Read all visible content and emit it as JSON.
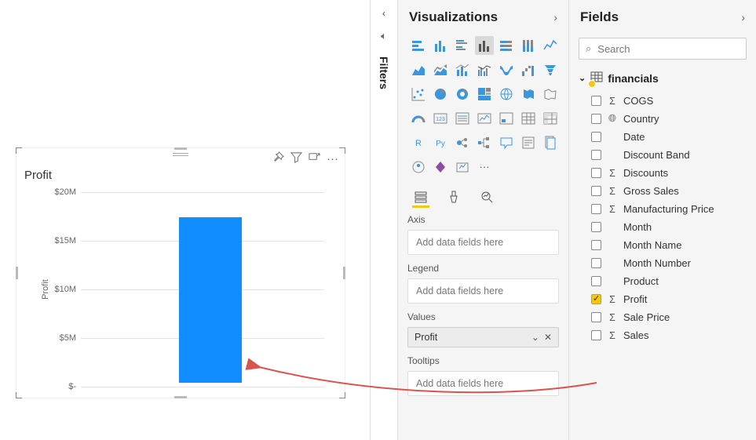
{
  "panes": {
    "filters_label": "Filters",
    "visualizations_label": "Visualizations",
    "fields_label": "Fields"
  },
  "search": {
    "placeholder": "Search"
  },
  "chart_data": {
    "type": "bar",
    "title": "Profit",
    "ylabel": "Profit",
    "ylim": [
      0,
      20
    ],
    "y_unit": "M",
    "y_prefix": "$",
    "ticks": [
      "$20M",
      "$15M",
      "$10M",
      "$5M",
      "$-"
    ],
    "categories": [
      ""
    ],
    "values": [
      17
    ]
  },
  "viz": {
    "tabs": {
      "fields": "Fields",
      "format": "Format",
      "analytics": "Analytics"
    },
    "wells": {
      "axis": {
        "label": "Axis",
        "placeholder": "Add data fields here"
      },
      "legend": {
        "label": "Legend",
        "placeholder": "Add data fields here"
      },
      "values": {
        "label": "Values",
        "chip": "Profit"
      },
      "tooltips": {
        "label": "Tooltips",
        "placeholder": "Add data fields here"
      }
    },
    "gallery_count": 37
  },
  "fields": {
    "table": "financials",
    "items": [
      {
        "name": "COGS",
        "icon": "sigma",
        "checked": false
      },
      {
        "name": "Country",
        "icon": "globe",
        "checked": false
      },
      {
        "name": "Date",
        "icon": "",
        "checked": false
      },
      {
        "name": "Discount Band",
        "icon": "",
        "checked": false
      },
      {
        "name": "Discounts",
        "icon": "sigma",
        "checked": false
      },
      {
        "name": "Gross Sales",
        "icon": "sigma",
        "checked": false
      },
      {
        "name": "Manufacturing Price",
        "icon": "sigma",
        "checked": false
      },
      {
        "name": "Month",
        "icon": "",
        "checked": false
      },
      {
        "name": "Month Name",
        "icon": "",
        "checked": false
      },
      {
        "name": "Month Number",
        "icon": "",
        "checked": false
      },
      {
        "name": "Product",
        "icon": "",
        "checked": false
      },
      {
        "name": "Profit",
        "icon": "sigma",
        "checked": true
      },
      {
        "name": "Sale Price",
        "icon": "sigma",
        "checked": false
      },
      {
        "name": "Sales",
        "icon": "sigma",
        "checked": false
      }
    ]
  }
}
